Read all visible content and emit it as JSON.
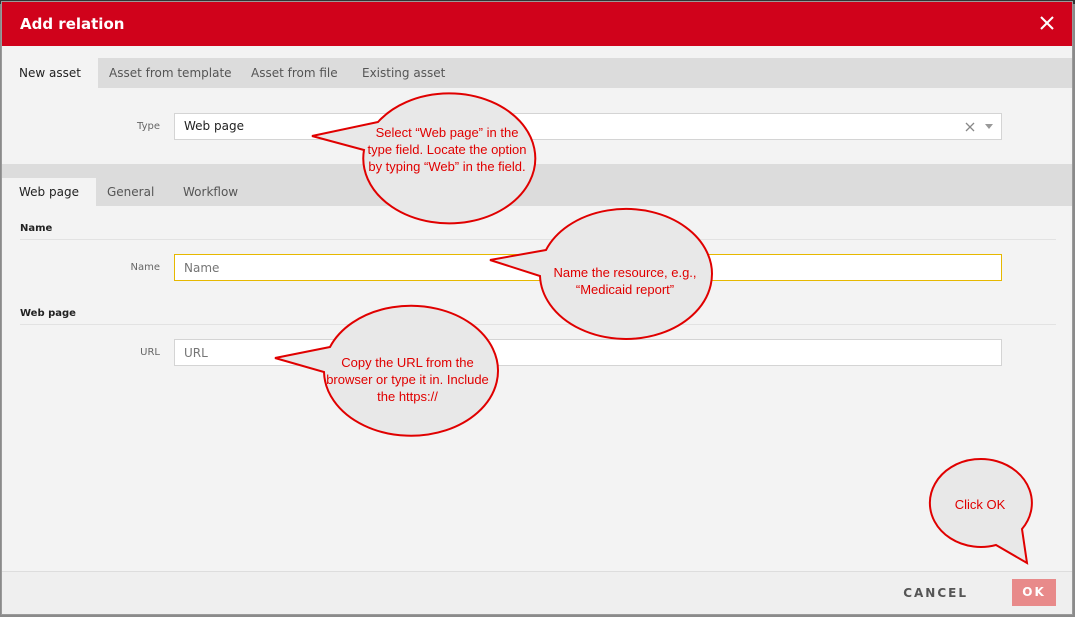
{
  "dialog": {
    "title": "Add relation",
    "close_icon": "close-icon",
    "colors": {
      "title_bar": "#d0021b",
      "ok_button": "#e88a8a",
      "callout_border": "#e00000",
      "callout_text": "#e00000"
    }
  },
  "top_tabs": [
    {
      "label": "New asset",
      "active": true
    },
    {
      "label": "Asset from template",
      "active": false
    },
    {
      "label": "Asset from file",
      "active": false
    },
    {
      "label": "Existing asset",
      "active": false
    }
  ],
  "type_field": {
    "label": "Type",
    "value": "Web page",
    "clear_icon": "clear-icon",
    "dropdown_icon": "chevron-down-icon"
  },
  "inner_tabs": [
    {
      "label": "Web page",
      "active": true
    },
    {
      "label": "General",
      "active": false
    },
    {
      "label": "Workflow",
      "active": false
    }
  ],
  "name_section": {
    "heading": "Name",
    "field_label": "Name",
    "placeholder": "Name"
  },
  "webpage_section": {
    "heading": "Web page",
    "field_label": "URL",
    "placeholder": "URL"
  },
  "footer": {
    "cancel_label": "CANCEL",
    "ok_label": "OK"
  },
  "callouts": [
    {
      "text": "Select “Web page” in the type field. Locate the option by typing “Web” in the field."
    },
    {
      "text": "Name the resource, e.g., “Medicaid report”"
    },
    {
      "text": "Copy the URL from the browser or type it in. Include the https://"
    },
    {
      "text": "Click OK"
    }
  ]
}
